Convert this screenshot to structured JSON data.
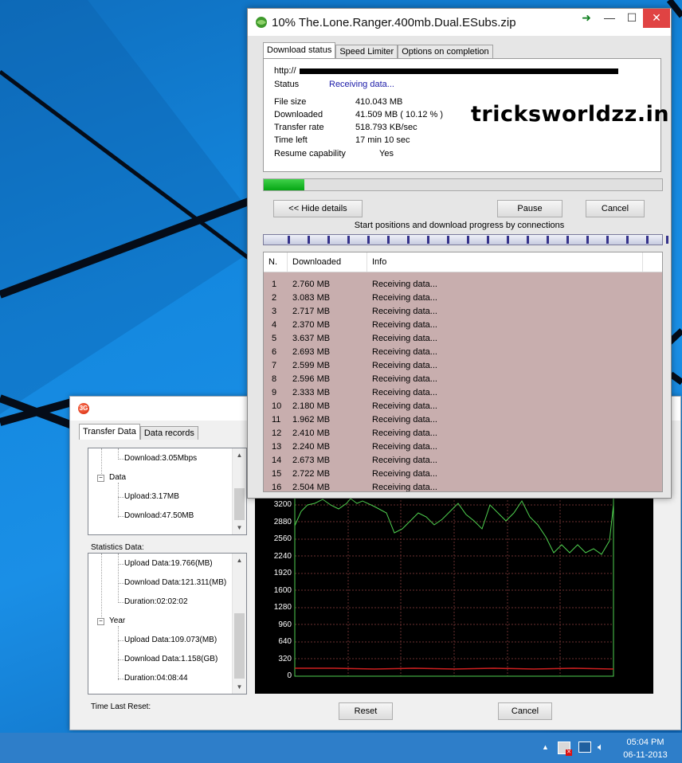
{
  "watermark": "tricksworldzz.in",
  "idm": {
    "title": "10% The.Lone.Ranger.400mb.Dual.ESubs.zip",
    "tabs": [
      "Download status",
      "Speed Limiter",
      "Options on completion"
    ],
    "url_prefix": "http://",
    "status_label": "Status",
    "status_value": "Receiving data...",
    "fields": [
      {
        "label": "File size",
        "value": "410.043  MB"
      },
      {
        "label": "Downloaded",
        "value": "41.509  MB  ( 10.12 % )"
      },
      {
        "label": "Transfer rate",
        "value": "518.793  KB/sec"
      },
      {
        "label": "Time left",
        "value": "17 min 10 sec"
      },
      {
        "label": "Resume capability",
        "value": "Yes"
      }
    ],
    "progress_percent": 10.12,
    "buttons": {
      "hide_details": "<< Hide details",
      "pause": "Pause",
      "cancel": "Cancel"
    },
    "connections_caption": "Start positions and download progress by connections",
    "list_headers": [
      "N.",
      "Downloaded",
      "Info"
    ],
    "rows": [
      {
        "n": "1",
        "downloaded": "2.760  MB",
        "info": "Receiving data..."
      },
      {
        "n": "2",
        "downloaded": "3.083  MB",
        "info": "Receiving data..."
      },
      {
        "n": "3",
        "downloaded": "2.717  MB",
        "info": "Receiving data..."
      },
      {
        "n": "4",
        "downloaded": "2.370  MB",
        "info": "Receiving data..."
      },
      {
        "n": "5",
        "downloaded": "3.637  MB",
        "info": "Receiving data..."
      },
      {
        "n": "6",
        "downloaded": "2.693  MB",
        "info": "Receiving data..."
      },
      {
        "n": "7",
        "downloaded": "2.599  MB",
        "info": "Receiving data..."
      },
      {
        "n": "8",
        "downloaded": "2.596  MB",
        "info": "Receiving data..."
      },
      {
        "n": "9",
        "downloaded": "2.333  MB",
        "info": "Receiving data..."
      },
      {
        "n": "10",
        "downloaded": "2.180  MB",
        "info": "Receiving data..."
      },
      {
        "n": "11",
        "downloaded": "1.962  MB",
        "info": "Receiving data..."
      },
      {
        "n": "12",
        "downloaded": "2.410  MB",
        "info": "Receiving data..."
      },
      {
        "n": "13",
        "downloaded": "2.240  MB",
        "info": "Receiving data..."
      },
      {
        "n": "14",
        "downloaded": "2.673  MB",
        "info": "Receiving data..."
      },
      {
        "n": "15",
        "downloaded": "2.722  MB",
        "info": "Receiving data..."
      },
      {
        "n": "16",
        "downloaded": "2.504  MB",
        "info": "Receiving data..."
      }
    ]
  },
  "monitor": {
    "app_icon_text": "3G",
    "tabs": [
      "Transfer Data",
      "Data records"
    ],
    "tree1": [
      {
        "text": "Download:3.05Mbps"
      },
      {
        "text": "Data",
        "group": true
      },
      {
        "text": "Upload:3.17MB"
      },
      {
        "text": "Download:47.50MB"
      }
    ],
    "statistics_label": "Statistics Data:",
    "tree2": [
      {
        "text": "Upload Data:19.766(MB)"
      },
      {
        "text": "Download Data:121.311(MB)"
      },
      {
        "text": "Duration:02:02:02"
      },
      {
        "text": "Year",
        "group": true
      },
      {
        "text": "Upload Data:109.073(MB)"
      },
      {
        "text": "Download Data:1.158(GB)"
      },
      {
        "text": "Duration:04:08:44"
      }
    ],
    "time_last_reset_label": "Time Last Reset:",
    "reset_button": "Reset",
    "cancel_button": "Cancel",
    "graph_y_labels": [
      "3200",
      "2880",
      "2560",
      "2240",
      "1920",
      "1600",
      "1280",
      "960",
      "640",
      "320",
      "0"
    ]
  },
  "taskbar": {
    "time": "05:04 PM",
    "date": "06-11-2013"
  },
  "colors": {
    "desktop": "#1488df",
    "progress": "#06a614",
    "list_bg": "#c8aeae",
    "graph_line": "#4fd04f",
    "graph_base": "#d02020"
  }
}
